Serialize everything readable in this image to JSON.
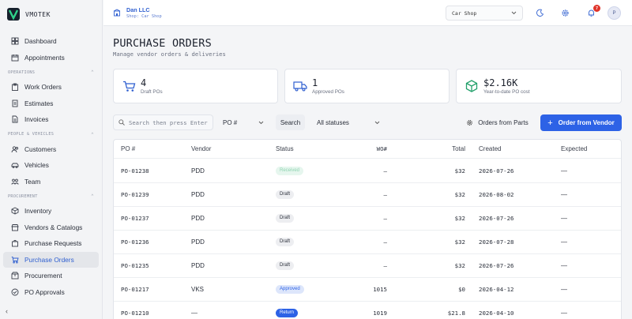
{
  "brand": {
    "name": "VMOTEK"
  },
  "sidebar": {
    "items_top": [
      {
        "label": "Dashboard",
        "icon": "grid-icon"
      },
      {
        "label": "Appointments",
        "icon": "calendar-icon"
      }
    ],
    "sections": [
      {
        "title": "OPERATIONS",
        "items": [
          {
            "label": "Work Orders",
            "icon": "clipboard-icon"
          },
          {
            "label": "Estimates",
            "icon": "document-icon"
          },
          {
            "label": "Invoices",
            "icon": "file-icon"
          }
        ]
      },
      {
        "title": "PEOPLE & VEHICLES",
        "items": [
          {
            "label": "Customers",
            "icon": "users-icon"
          },
          {
            "label": "Vehicles",
            "icon": "car-icon"
          },
          {
            "label": "Team",
            "icon": "team-icon"
          }
        ]
      },
      {
        "title": "PROCUREMENT",
        "items": [
          {
            "label": "Inventory",
            "icon": "box-icon"
          },
          {
            "label": "Vendors & Catalogs",
            "icon": "store-icon"
          },
          {
            "label": "Purchase Requests",
            "icon": "bag-icon"
          },
          {
            "label": "Purchase Orders",
            "icon": "cart-icon",
            "active": true
          },
          {
            "label": "Procurement",
            "icon": "package-icon"
          },
          {
            "label": "PO Approvals",
            "icon": "check-shield-icon"
          }
        ]
      }
    ]
  },
  "topbar": {
    "org_name": "Dan LLC",
    "org_sub": "Shop: Car Shop",
    "shop_select": "Car Shop",
    "notifications": "7",
    "avatar": "P"
  },
  "page": {
    "title": "PURCHASE ORDERS",
    "subtitle": "Manage vendor orders & deliveries"
  },
  "stats": [
    {
      "value": "4",
      "label": "Draft POs",
      "icon": "cart-icon"
    },
    {
      "value": "1",
      "label": "Approved POs",
      "icon": "truck-icon"
    },
    {
      "value": "$2.16K",
      "label": "Year-to-date PO cost",
      "icon": "cube-icon"
    }
  ],
  "toolbar": {
    "search_placeholder": "Search then press Enter",
    "field_select": "PO #",
    "search_button": "Search",
    "status_select": "All statuses",
    "parts_button": "Orders from Parts",
    "vendor_button": "Order from Vendor"
  },
  "table": {
    "columns": [
      "PO #",
      "Vendor",
      "Status",
      "WO#",
      "Total",
      "Created",
      "Expected"
    ],
    "rows": [
      {
        "po": "PO-01238",
        "vendor": "PDD",
        "status": "Received",
        "status_type": "received",
        "wo": "–",
        "total": "$32",
        "created": "2026-07-26",
        "expected": "—"
      },
      {
        "po": "PO-01239",
        "vendor": "PDD",
        "status": "Draft",
        "status_type": "draft",
        "wo": "–",
        "total": "$32",
        "created": "2026-08-02",
        "expected": "—"
      },
      {
        "po": "PO-01237",
        "vendor": "PDD",
        "status": "Draft",
        "status_type": "draft",
        "wo": "–",
        "total": "$32",
        "created": "2026-07-26",
        "expected": "—"
      },
      {
        "po": "PO-01236",
        "vendor": "PDD",
        "status": "Draft",
        "status_type": "draft",
        "wo": "–",
        "total": "$32",
        "created": "2026-07-28",
        "expected": "—"
      },
      {
        "po": "PO-01235",
        "vendor": "PDD",
        "status": "Draft",
        "status_type": "draft",
        "wo": "–",
        "total": "$32",
        "created": "2026-07-26",
        "expected": "—"
      },
      {
        "po": "PO-01217",
        "vendor": "VKS",
        "status": "Approved",
        "status_type": "approved",
        "wo": "1015",
        "total": "$0",
        "created": "2026-04-12",
        "expected": "—"
      },
      {
        "po": "PO-01210",
        "vendor": "—",
        "status": "Return",
        "status_type": "return",
        "wo": "1019",
        "total": "$21.8",
        "created": "2026-04-10",
        "expected": "—"
      }
    ]
  },
  "colors": {
    "accent": "#2d62e6",
    "green": "#22a06b"
  }
}
